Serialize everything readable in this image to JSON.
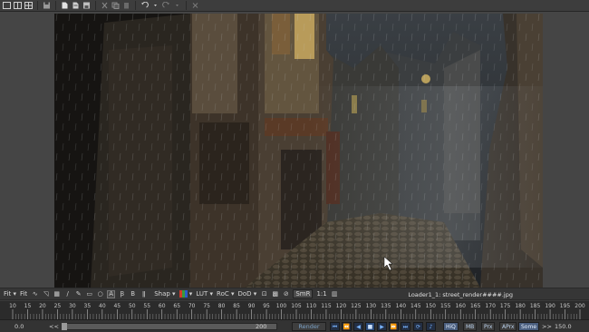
{
  "toolbar": {
    "icons": [
      "layout-single-icon",
      "layout-split-icon",
      "layout-quad-icon",
      "save-icon",
      "new-file-icon",
      "open-file-icon",
      "save-file-icon",
      "cut-icon",
      "copy-icon",
      "paste-icon",
      "undo-icon",
      "redo-icon",
      "close-icon"
    ]
  },
  "viewer": {
    "image_description_none": ""
  },
  "viewer_controls": {
    "fit_label": "Fit",
    "fit_value": "Fit",
    "shape_label": "Shap",
    "lut_label": "LUT",
    "roc_label": "RoC",
    "dod_label": "DoD",
    "smr_label": "SmR",
    "ratio_label": "1:1",
    "loader_text": "Loader1_1: street_render####.jpg",
    "swatch_colors": [
      "#d23a2a",
      "#3a9a3a",
      "#2e5ac8"
    ]
  },
  "timeline": {
    "ticks": [
      "10",
      "15",
      "20",
      "25",
      "30",
      "35",
      "40",
      "45",
      "50",
      "55",
      "60",
      "65",
      "70",
      "75",
      "80",
      "85",
      "90",
      "95",
      "100",
      "105",
      "110",
      "115",
      "120",
      "125",
      "130",
      "135",
      "140",
      "145",
      "150",
      "155",
      "160",
      "165",
      "170",
      "175",
      "180",
      "185",
      "190",
      "195",
      "200"
    ],
    "current_frame": 0
  },
  "transport": {
    "start_value": "0.0",
    "prev_label": "<<",
    "range_end": "200",
    "render_label": "Render",
    "hiq_label": "HiQ",
    "mb_label": "MB",
    "prx_label": "Prx",
    "aprx_label": "APrx",
    "some_label": "Some",
    "next_label": ">>",
    "end_value": "150.0",
    "accent_color": "#79b4ff"
  }
}
